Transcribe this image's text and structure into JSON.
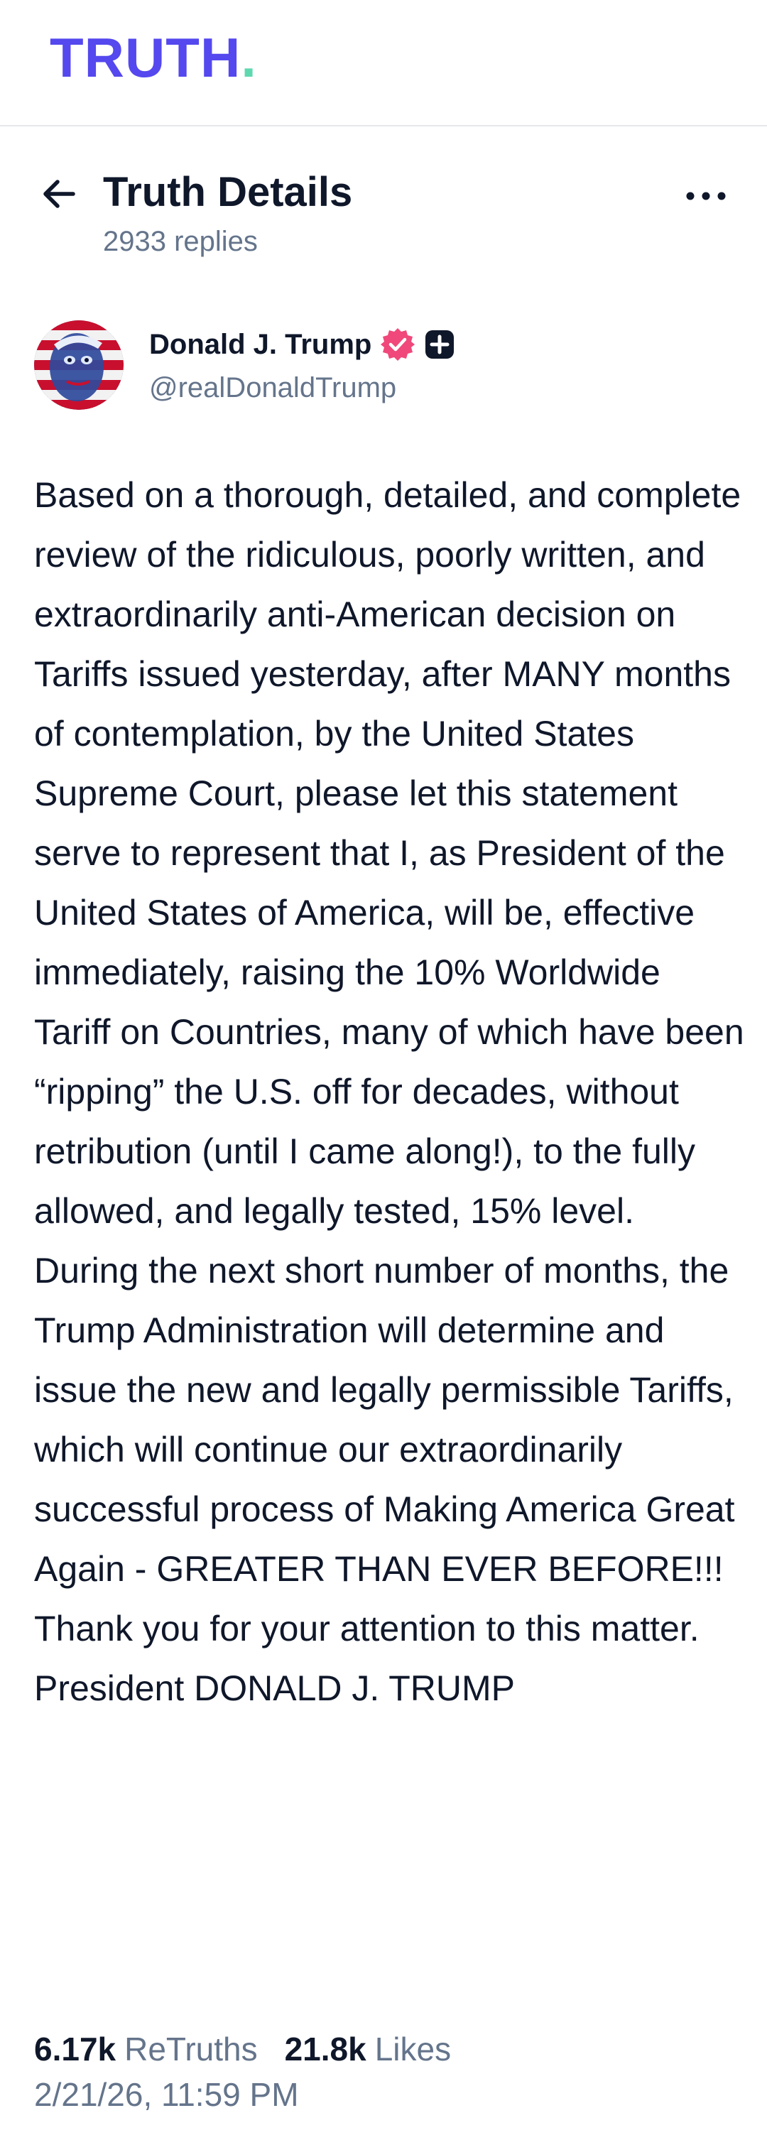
{
  "brand": {
    "name": "TRUTH",
    "dot": ".",
    "primary_color": "#5448ee",
    "dot_color": "#5fd8b0"
  },
  "header": {
    "back_icon": "arrow-left-icon",
    "title": "Truth Details",
    "reply_count": "2933 replies",
    "more_icon": "more-horizontal-icon"
  },
  "author": {
    "name": "Donald J. Trump",
    "handle": "@realDonaldTrump",
    "verified_icon": "verified-badge-icon",
    "verified_color": "#f0487a",
    "plus_icon": "plus-badge-icon"
  },
  "post": {
    "text": "Based on a thorough, detailed, and complete review of the ridiculous, poorly written, and extraordinarily anti-American decision on Tariffs issued yesterday, after MANY months of contemplation, by the United States Supreme Court, please let this statement serve to represent that I, as President of the United States of America, will be, effective immediately, raising the 10% Worldwide Tariff on Countries, many of which have been “ripping” the U.S. off for decades, without retribution (until I came along!), to the fully allowed, and legally tested, 15% level. During the next short number of months, the Trump Administration will determine and issue the new and legally permissible Tariffs, which will continue our extraordinarily successful process of Making America Great Again - GREATER THAN EVER BEFORE!!! Thank you for your attention to this matter. President DONALD J. TRUMP"
  },
  "stats": {
    "retruths_count": "6.17k",
    "retruths_label": "ReTruths",
    "likes_count": "21.8k",
    "likes_label": "Likes"
  },
  "timestamp": "2/21/26, 11:59 PM"
}
